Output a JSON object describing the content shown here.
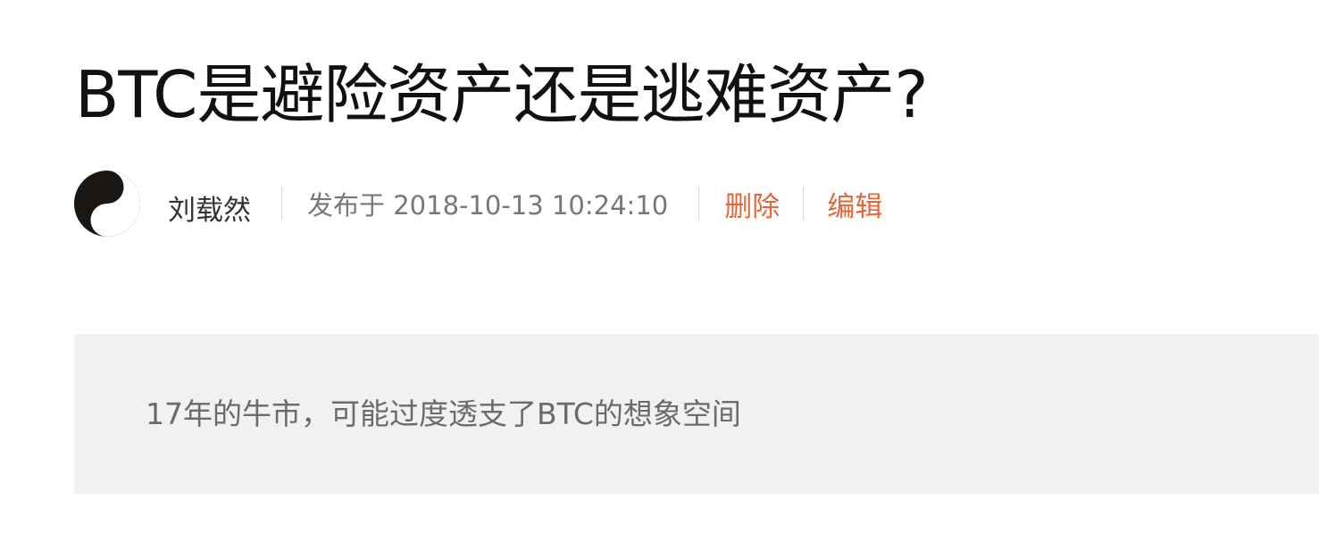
{
  "article": {
    "title": "BTC是避险资产还是逃难资产?",
    "author": "刘载然",
    "published": "发布于 2018-10-13 10:24:10",
    "actions": {
      "delete_label": "删除",
      "edit_label": "编辑"
    },
    "summary": "17年的牛市，可能过度透支了BTC的想象空间"
  },
  "colors": {
    "action": "#e0683a",
    "summary_bg": "#f1f1f3"
  }
}
